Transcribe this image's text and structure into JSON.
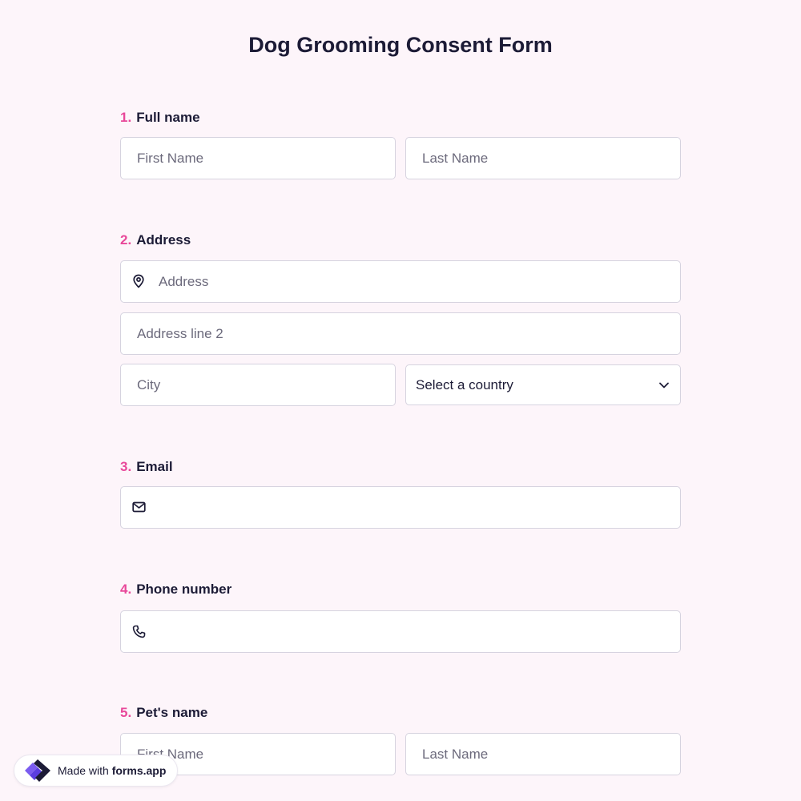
{
  "form": {
    "title": "Dog Grooming Consent Form",
    "accent_color": "#e8489a",
    "background_color": "#fdf5fa",
    "questions": {
      "full_name": {
        "number": "1.",
        "label": "Full name",
        "first_placeholder": "First Name",
        "last_placeholder": "Last Name"
      },
      "address": {
        "number": "2.",
        "label": "Address",
        "icon": "location-pin-icon",
        "line1_placeholder": "Address",
        "line2_placeholder": "Address line 2",
        "city_placeholder": "City",
        "country_selected": "Select a country"
      },
      "email": {
        "number": "3.",
        "label": "Email",
        "icon": "mail-icon"
      },
      "phone": {
        "number": "4.",
        "label": "Phone number",
        "icon": "phone-icon"
      },
      "pet_name": {
        "number": "5.",
        "label": "Pet's name",
        "first_placeholder": "First Name",
        "last_placeholder": "Last Name"
      }
    }
  },
  "badge": {
    "prefix": "Made with ",
    "brand": "forms.app",
    "logo": "forms-app-logo"
  }
}
